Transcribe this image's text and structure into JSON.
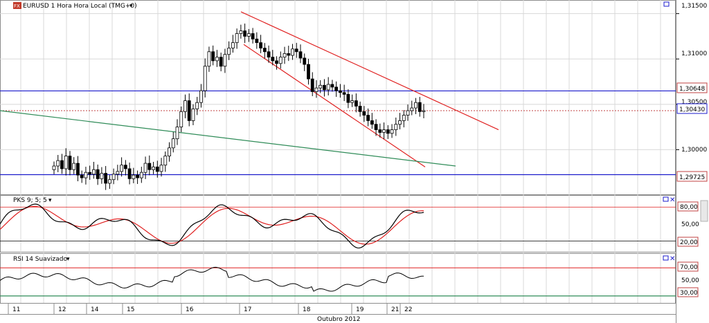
{
  "header": {
    "symbol_label": "EURUSD 1 Hora Hora Local (TMG+0)",
    "dropdown_glyph": "▾"
  },
  "colors": {
    "grid": "#d8d8d8",
    "candle": "#000000",
    "redline": "#e02020",
    "blueline": "#1a1acc",
    "greenline": "#2e8b57",
    "price_dotted": "#c04040"
  },
  "price_axis": {
    "ticks": [
      "1,31500",
      "1,31000",
      "1,30500",
      "1,30000"
    ],
    "ticks_values": [
      1.315,
      1.31,
      1.305,
      1.3
    ],
    "level_high_label": "1,30648",
    "level_high_value": 1.30648,
    "current_label": "1,30430",
    "current_value": 1.3043,
    "level_low_label": "1,29725",
    "level_low_value": 1.29725
  },
  "pks": {
    "title": "PKS 9; 5; 5",
    "ticks": [
      "80,00",
      "50,00",
      "20,00"
    ],
    "ticks_values": [
      80,
      50,
      20
    ]
  },
  "rsi": {
    "title": "RSI 14 Suavizado",
    "ticks": [
      "70,00",
      "50,00",
      "30,00"
    ],
    "ticks_values": [
      70,
      50,
      30
    ]
  },
  "time_axis": {
    "day_labels": [
      "11",
      "12",
      "14",
      "15",
      "16",
      "17",
      "18",
      "19",
      "21",
      "22"
    ],
    "month_label": "Outubro 2012"
  },
  "chart_data": {
    "type": "candlestick",
    "title": "EURUSD 1 Hora Hora Local (TMG+0)",
    "ylim": [
      1.295,
      1.3165
    ],
    "closes": [
      1.2982,
      1.2988,
      1.2979,
      1.2993,
      1.2978,
      1.2985,
      1.2972,
      1.2969,
      1.2975,
      1.2973,
      1.2978,
      1.2968,
      1.2974,
      1.2963,
      1.2967,
      1.2973,
      1.2976,
      1.2983,
      1.2979,
      1.2968,
      1.2972,
      1.2969,
      1.2975,
      1.2985,
      1.2978,
      1.2981,
      1.2976,
      1.2983,
      1.2993,
      1.3002,
      1.3012,
      1.3025,
      1.3042,
      1.3054,
      1.3032,
      1.3045,
      1.3052,
      1.3065,
      1.3092,
      1.3108,
      1.3098,
      1.3102,
      1.3092,
      1.3105,
      1.3112,
      1.3118,
      1.3128,
      1.3131,
      1.3125,
      1.3128,
      1.3122,
      1.3118,
      1.3112,
      1.3108,
      1.3102,
      1.3098,
      1.3095,
      1.3102,
      1.3106,
      1.3104,
      1.3111,
      1.3108,
      1.3101,
      1.3094,
      1.3078,
      1.3064,
      1.3068,
      1.3071,
      1.3066,
      1.3072,
      1.3069,
      1.3065,
      1.3063,
      1.3061,
      1.3052,
      1.3054,
      1.3048,
      1.3042,
      1.3038,
      1.3032,
      1.3028,
      1.3022,
      1.3019,
      1.3022,
      1.3018,
      1.3022,
      1.3028,
      1.3032,
      1.3038,
      1.3043,
      1.3046,
      1.3052,
      1.3042,
      1.3043
    ],
    "bearish_channel_upper": [
      [
        1.3152,
        0
      ],
      [
        1.3022,
        94
      ]
    ],
    "bearish_channel_lower": [
      [
        1.3116,
        0
      ],
      [
        1.2981,
        94
      ]
    ],
    "long_trendline": [
      [
        1.3043,
        0
      ],
      [
        1.2982,
        94
      ]
    ],
    "horizontal_levels": [
      1.30648,
      1.3043,
      1.29725
    ]
  }
}
